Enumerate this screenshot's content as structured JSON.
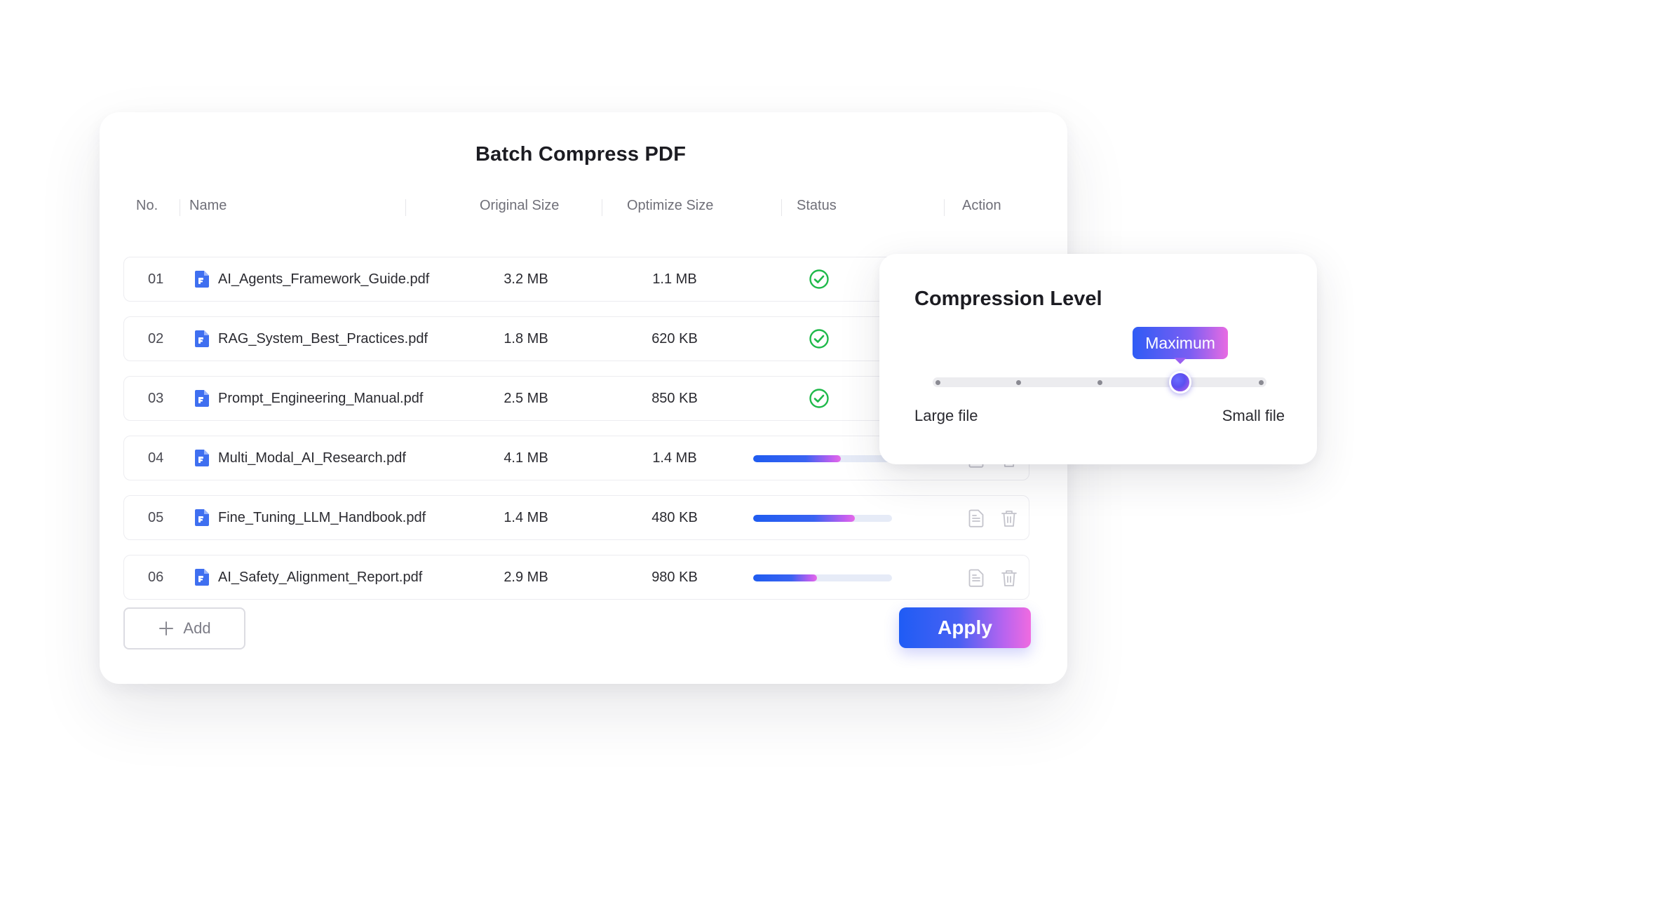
{
  "panel": {
    "title": "Batch Compress PDF",
    "columns": {
      "no": "No.",
      "name": "Name",
      "original_size": "Original Size",
      "optimize_size": "Optimize Size",
      "status": "Status",
      "action": "Action"
    },
    "rows": [
      {
        "no": "01",
        "name": "AI_Agents_Framework_Guide.pdf",
        "original_size": "3.2 MB",
        "optimize_size": "1.1 MB",
        "status": "done"
      },
      {
        "no": "02",
        "name": "RAG_System_Best_Practices.pdf",
        "original_size": "1.8 MB",
        "optimize_size": "620 KB",
        "status": "done"
      },
      {
        "no": "03",
        "name": "Prompt_Engineering_Manual.pdf",
        "original_size": "2.5 MB",
        "optimize_size": "850 KB",
        "status": "done"
      },
      {
        "no": "04",
        "name": "Multi_Modal_AI_Research.pdf",
        "original_size": "4.1 MB",
        "optimize_size": "1.4 MB",
        "status": "progress",
        "progress": 0.63
      },
      {
        "no": "05",
        "name": "Fine_Tuning_LLM_Handbook.pdf",
        "original_size": "1.4 MB",
        "optimize_size": "480 KB",
        "status": "progress",
        "progress": 0.73
      },
      {
        "no": "06",
        "name": "AI_Safety_Alignment_Report.pdf",
        "original_size": "2.9 MB",
        "optimize_size": "980 KB",
        "status": "progress",
        "progress": 0.46
      }
    ],
    "add_label": "Add",
    "apply_label": "Apply"
  },
  "compression": {
    "title": "Compression Level",
    "levels": 5,
    "selected_level": 4,
    "selected_label": "Maximum",
    "min_label": "Large file",
    "max_label": "Small file"
  },
  "colors": {
    "accent_blue": "#1f5cf5",
    "accent_pink": "#f06be0",
    "success_green": "#1fb94a",
    "file_icon_blue": "#3f6ff0"
  },
  "icons": {
    "file": "pdf-file-icon",
    "status_done": "check-circle-icon",
    "preview": "document-icon",
    "delete": "trash-icon",
    "add": "plus-icon"
  }
}
